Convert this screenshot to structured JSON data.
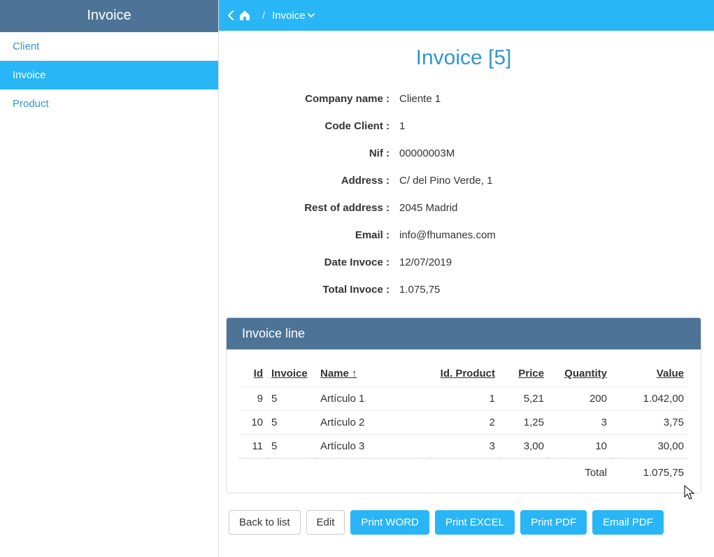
{
  "sidebar": {
    "title": "Invoice",
    "items": [
      {
        "label": "Client",
        "active": false
      },
      {
        "label": "Invoice",
        "active": true
      },
      {
        "label": "Product",
        "active": false
      }
    ]
  },
  "breadcrumb": {
    "current": "Invoice"
  },
  "page": {
    "title": "Invoice [5]"
  },
  "details": {
    "company_name_label": "Company name :",
    "company_name_value": "Cliente 1",
    "code_client_label": "Code Client :",
    "code_client_value": "1",
    "nif_label": "Nif :",
    "nif_value": "00000003M",
    "address_label": "Address :",
    "address_value": "C/ del Pino Verde, 1",
    "rest_address_label": "Rest of address :",
    "rest_address_value": "2045 Madrid",
    "email_label": "Email :",
    "email_value": "info@fhumanes.com",
    "date_label": "Date Invoce :",
    "date_value": "12/07/2019",
    "total_label": "Total Invoce :",
    "total_value": "1.075,75"
  },
  "line_panel": {
    "title": "Invoice line",
    "columns": {
      "id": "Id",
      "invoice": "Invoice",
      "name": "Name",
      "id_product": "Id. Product",
      "price": "Price",
      "quantity": "Quantity",
      "value": "Value"
    },
    "rows": [
      {
        "id": "9",
        "invoice": "5",
        "name": "Artículo 1",
        "id_product": "1",
        "price": "5,21",
        "quantity": "200",
        "value": "1.042,00"
      },
      {
        "id": "10",
        "invoice": "5",
        "name": "Artículo 2",
        "id_product": "2",
        "price": "1,25",
        "quantity": "3",
        "value": "3,75"
      },
      {
        "id": "11",
        "invoice": "5",
        "name": "Artículo 3",
        "id_product": "3",
        "price": "3,00",
        "quantity": "10",
        "value": "30,00"
      }
    ],
    "total_label": "Total",
    "total_value": "1.075,75"
  },
  "actions": {
    "back": "Back to list",
    "edit": "Edit",
    "print_word": "Print WORD",
    "print_excel": "Print EXCEL",
    "print_pdf": "Print PDF",
    "email_pdf": "Email PDF"
  }
}
